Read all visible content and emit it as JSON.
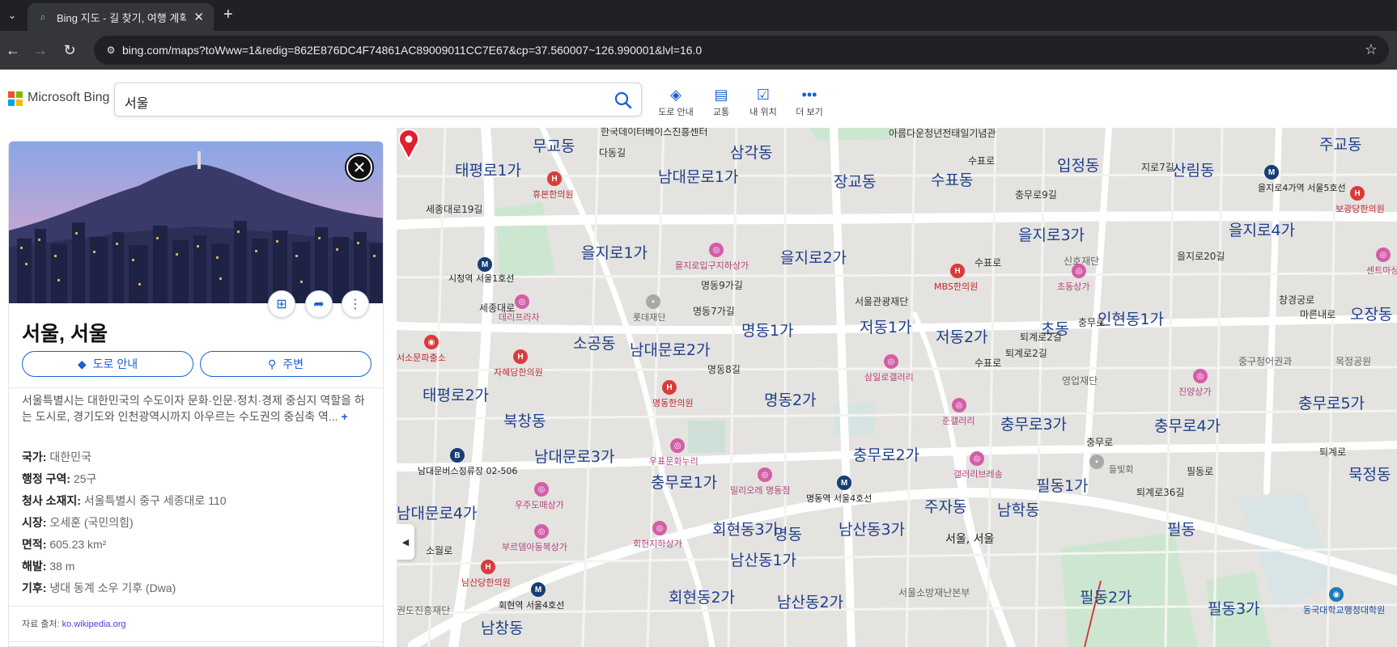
{
  "browser": {
    "tab_title": "Bing 지도 - 길 찾기, 여행 계획",
    "url": "bing.com/maps?toWww=1&redig=862E876DC4F74861AC89009011CC7E67&cp=37.560007~126.990001&lvl=16.0"
  },
  "header": {
    "brand": "Microsoft Bing",
    "search_value": "서울",
    "actions": [
      {
        "label": "도로 안내",
        "icon": "directions-icon"
      },
      {
        "label": "교통",
        "icon": "traffic-icon"
      },
      {
        "label": "내 위치",
        "icon": "my-location-icon"
      },
      {
        "label": "더 보기",
        "icon": "more-icon"
      }
    ]
  },
  "panel": {
    "title": "서울, 서울",
    "directions_label": "도로 안내",
    "nearby_label": "주변",
    "description": "서울특별시는 대한민국의 수도이자 문화·인문·정치·경제 중심지 역할을 하는 도시로, 경기도와 인천광역시까지 아우르는 수도권의 중심축 역...",
    "more_label": "+",
    "facts": [
      {
        "key": "국가:",
        "value": "대한민국"
      },
      {
        "key": "행정 구역:",
        "value": "25구"
      },
      {
        "key": "청사 소재지:",
        "value": "서울특별시 중구 세종대로 110"
      },
      {
        "key": "시장:",
        "value": "오세훈 (국민의힘)"
      },
      {
        "key": "면적:",
        "value": "605.23 km²"
      },
      {
        "key": "해발:",
        "value": "38 m"
      },
      {
        "key": "기후:",
        "value": "냉대 동계 소우 기후 (Dwa)"
      }
    ],
    "source_label": "자료 출처:",
    "source_link": "ko.wikipedia.org"
  },
  "map": {
    "pin_label": "서울, 서울",
    "district_labels": [
      "무교동",
      "삼각동",
      "태평로1가",
      "남대문로1가",
      "장교동",
      "수표동",
      "입정동",
      "산림동",
      "주교동",
      "을지로1가",
      "을지로2가",
      "을지로3가",
      "을지로4가",
      "소공동",
      "남대문로2가",
      "명동1가",
      "저동1가",
      "저동2가",
      "초동",
      "인현동1가",
      "오장동",
      "태평로2가",
      "북창동",
      "명동2가",
      "충무로3가",
      "충무로4가",
      "충무로5가",
      "남대문로3가",
      "충무로2가",
      "충무로1가",
      "필동1가",
      "묵정동",
      "남대문로4가",
      "주자동",
      "남학동",
      "회현동3가",
      "명동",
      "남산동3가",
      "필동",
      "남산동1가",
      "회현동2가",
      "남산동2가",
      "필동2가",
      "필동3가",
      "남창동"
    ],
    "street_labels": [
      "한국데이터베이스진흥센터",
      "다동길",
      "아름다운청년전태일기념관",
      "수표로",
      "충무로9길",
      "지로7길",
      "세종대로19길",
      "명동9가길",
      "명동7가길",
      "서울관광재단",
      "수표로",
      "세종대로",
      "마른내로",
      "중구청어권과",
      "목정공원",
      "신호재단",
      "영업재단",
      "퇴계로2길",
      "수표로",
      "명동8길",
      "충무로",
      "퇴계로36길",
      "필동로",
      "퇴계로",
      "소월로",
      "서울소방재난본부",
      "권도진흥재단",
      "퇴계로2길",
      "을지로20길",
      "창경궁로",
      "충무로"
    ],
    "poi_labels": [
      "휴본한의원",
      "을지로입구지하상가",
      "시청역 서울1호선",
      "데리프라자",
      "롯데재단",
      "서소문파출소",
      "자혜당한의원",
      "명동한의원",
      "삼일로갤러리",
      "준갤러리",
      "초동상가",
      "MBS한의원",
      "진양상가",
      "을지로4가역 서울5호선",
      "보광당한의원",
      "센트마상",
      "남대문버스정류장 02-506",
      "우표문화누리",
      "밀리오레 명동점",
      "명동역 서울4호선",
      "갤러리브레송",
      "우주도매상가",
      "부르뎀아동복상가",
      "회현지하상가",
      "남산당한의원",
      "회현역 서울4호선",
      "들빛회",
      "동국대학교행정대학원"
    ],
    "colors": {
      "road": "#ffffff",
      "block": "#e4e3e0",
      "park": "#cde6d0",
      "pin": "#e11f2f"
    }
  }
}
